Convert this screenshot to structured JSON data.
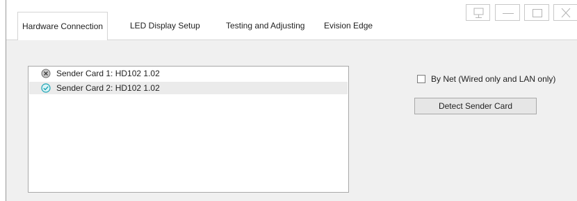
{
  "tabs": [
    {
      "label": "Hardware Connection",
      "active": true
    },
    {
      "label": "LED Display Setup",
      "active": false
    },
    {
      "label": "Testing and Adjusting",
      "active": false
    },
    {
      "label": "Evision Edge",
      "active": false
    }
  ],
  "window_controls": [
    {
      "icon": "monitor-icon"
    },
    {
      "icon": "minimize-icon"
    },
    {
      "icon": "maximize-icon"
    },
    {
      "icon": "close-icon"
    }
  ],
  "sender_cards": [
    {
      "label": "Sender Card 1: HD102 1.02",
      "status": "disconnected",
      "status_icon": "x-circle-icon",
      "selected": false
    },
    {
      "label": "Sender Card 2: HD102 1.02",
      "status": "connected",
      "status_icon": "check-circle-icon",
      "selected": true
    }
  ],
  "by_net": {
    "label": "By Net (Wired only and LAN only)",
    "checked": false
  },
  "detect_button": {
    "label": "Detect Sender Card"
  },
  "colors": {
    "connected_icon": "#1aa3b3",
    "disconnected_icon": "#6e6e6e",
    "content_bg": "#f0f0f0",
    "selected_row": "#ebebeb"
  }
}
